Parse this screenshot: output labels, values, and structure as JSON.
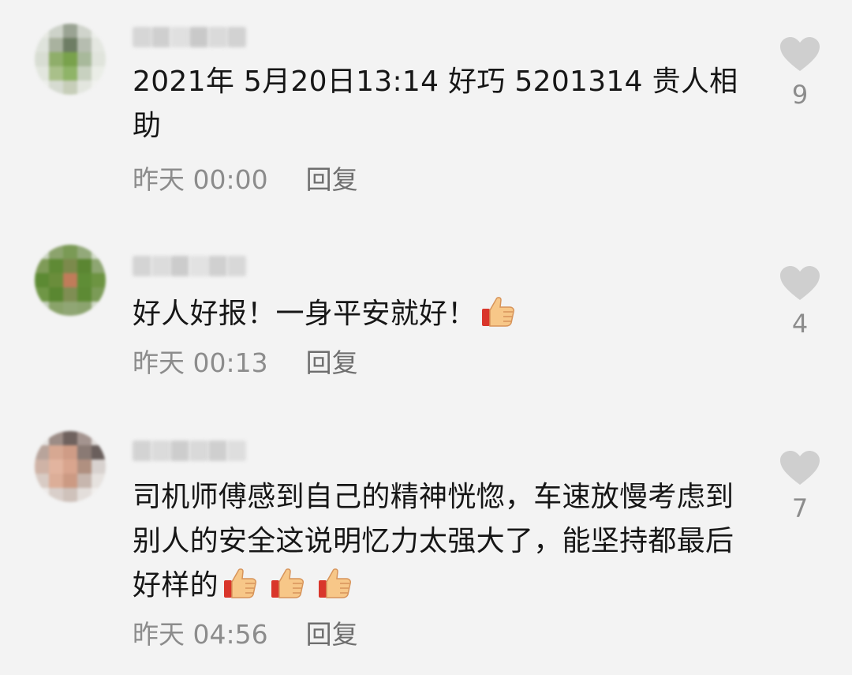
{
  "comments": [
    {
      "text": "2021年 5月20日13:14 好巧 5201314 贵人相助",
      "time": "昨天 00:00",
      "reply_label": "回复",
      "likes": "9",
      "thumbs_emoji_count": 0
    },
    {
      "text": "好人好报！一身平安就好！",
      "time": "昨天 00:13",
      "reply_label": "回复",
      "likes": "4",
      "thumbs_emoji_count": 1
    },
    {
      "text": "司机师傅感到自己的精神恍惚，车速放慢考虑到别人的安全这说明忆力太强大了，能坚持都最后好样的",
      "time": "昨天 04:56",
      "reply_label": "回复",
      "likes": "7",
      "thumbs_emoji_count": 3
    }
  ],
  "icons": {
    "like": "heart-icon",
    "emoji": "thumbs-up-emoji"
  },
  "colors": {
    "background": "#f3f3f3",
    "text": "#161616",
    "meta": "#8c8c8c",
    "heart": "#cfcfcf"
  }
}
